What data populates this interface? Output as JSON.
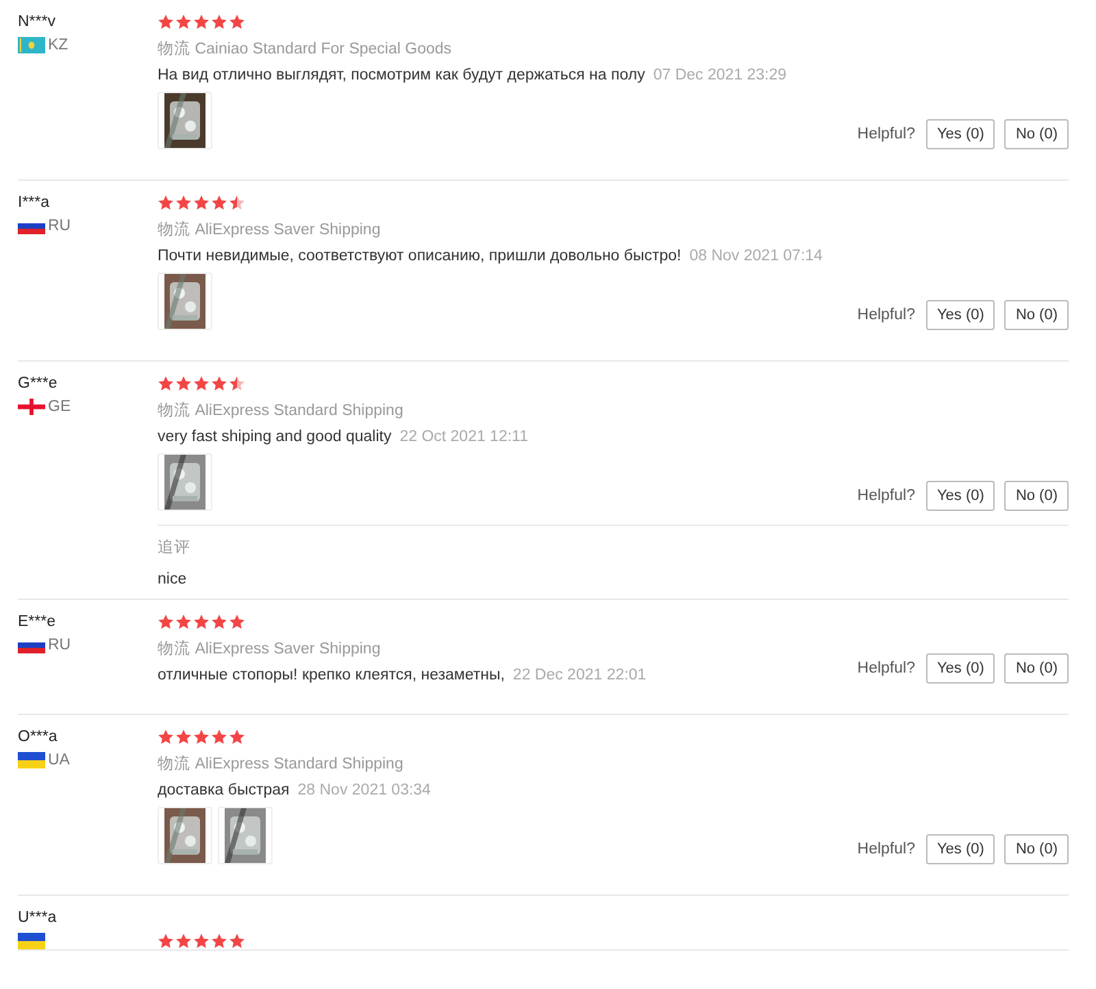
{
  "reviews": [
    {
      "name": "N***v",
      "country": "KZ",
      "flag": {
        "kind": "kz"
      },
      "stars": 5,
      "shipping_label": "物流",
      "shipping": "Cainiao Standard For Special Goods",
      "text": "На вид отлично выглядят, посмотрим как будут держаться на полу",
      "date": "07 Dec 2021 23:29",
      "photos": [
        {
          "kind": "picture"
        }
      ],
      "helpful_label": "Helpful?",
      "yes": "Yes (0)",
      "no": "No (0)"
    },
    {
      "name": "I***a",
      "country": "RU",
      "flag": {
        "kind": "ru"
      },
      "stars": 4.5,
      "shipping_label": "物流",
      "shipping": "AliExpress Saver Shipping",
      "text": "Почти невидимые, соответствуют описанию, пришли довольно быстро!",
      "date": "08 Nov 2021 07:14",
      "photos": [
        {
          "kind": "picture"
        }
      ],
      "helpful_label": "Helpful?",
      "yes": "Yes (0)",
      "no": "No (0)"
    },
    {
      "name": "G***e",
      "country": "GE",
      "flag": {
        "kind": "ge"
      },
      "stars": 4.5,
      "shipping_label": "物流",
      "shipping": "AliExpress Standard Shipping",
      "text": "very fast shiping and good quality",
      "date": "22 Oct 2021 12:11",
      "photos": [
        {
          "kind": "picture"
        }
      ],
      "helpful_label": "Helpful?",
      "yes": "Yes (0)",
      "no": "No (0)",
      "followup": {
        "label": "追评",
        "text": "nice"
      }
    },
    {
      "name": "E***e",
      "country": "RU",
      "flag": {
        "kind": "ru"
      },
      "stars": 5,
      "shipping_label": "物流",
      "shipping": "AliExpress Saver Shipping",
      "text": "отличные стопоры! крепко клеятся, незаметны,",
      "date": "22 Dec 2021 22:01",
      "helpful_label": "Helpful?",
      "yes": "Yes (0)",
      "no": "No (0)"
    },
    {
      "name": "O***a",
      "country": "UA",
      "flag": {
        "kind": "ua"
      },
      "stars": 5,
      "shipping_label": "物流",
      "shipping": "AliExpress Standard Shipping",
      "text": "доставка быстрая",
      "date": "28 Nov 2021 03:34",
      "photos": [
        {
          "kind": "picture"
        },
        {
          "kind": "picture"
        }
      ],
      "helpful_label": "Helpful?",
      "yes": "Yes (0)",
      "no": "No (0)"
    },
    {
      "name": "U***a",
      "flag": {
        "kind": "ua"
      },
      "stars": 5
    }
  ]
}
